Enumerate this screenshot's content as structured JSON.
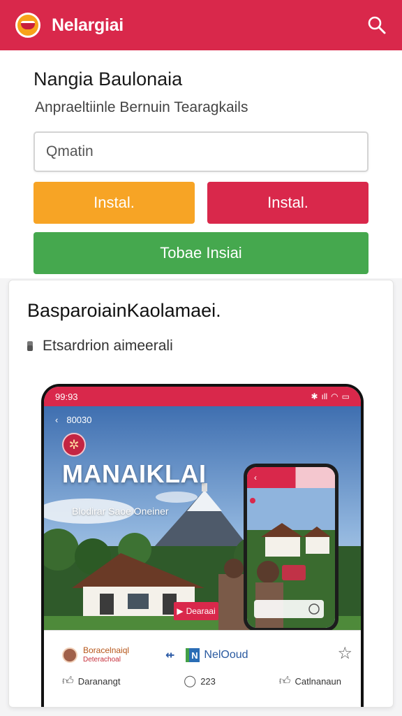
{
  "appbar": {
    "title": "Nelargiai",
    "logo_icon": "pot-logo-icon",
    "search_icon": "search-icon",
    "bg_color": "#d9284b"
  },
  "main": {
    "page_title": "Nangia Baulonaia",
    "subtitle": "Anpraeltiinle Bernuin Tearagkails",
    "search_placeholder": "Qmatin",
    "buttons": {
      "orange_label": "Instal.",
      "red_label": "Instal.",
      "green_label": "Tobae Insiai"
    },
    "colors": {
      "orange": "#f7a425",
      "red": "#d9284b",
      "green": "#45a84e"
    }
  },
  "card": {
    "title": "BasparoiainKaolamaei.",
    "bullet": "Etsardrion aimeerali",
    "phone_preview": {
      "time": "99:93",
      "back_label": "80030",
      "hero_title": "MANAIKLAI",
      "hero_subtitle": "Blodirar Saoe Oneiner",
      "cta_label": "Dearaai",
      "author_name": "Boracelnaiql",
      "author_sub": "Deterachoal",
      "service_name": "NelOoud",
      "service_badge": "N",
      "action_1": "Daranangt",
      "action_2": "223",
      "action_3": "Catlnanaun",
      "star_icon": "star-icon"
    }
  }
}
